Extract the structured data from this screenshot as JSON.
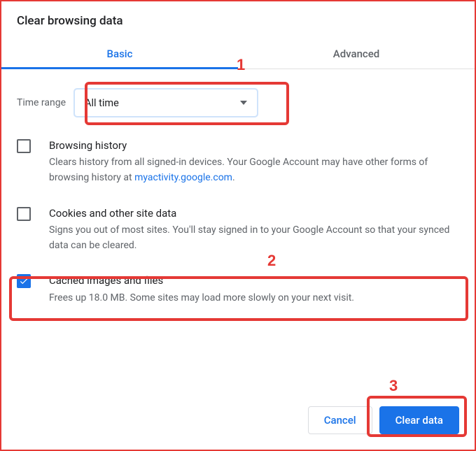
{
  "dialog": {
    "title": "Clear browsing data"
  },
  "tabs": {
    "basic": "Basic",
    "advanced": "Advanced"
  },
  "time_range": {
    "label": "Time range",
    "value": "All time"
  },
  "items": {
    "history": {
      "title": "Browsing history",
      "desc_pre": "Clears history from all signed-in devices. Your Google Account may have other forms of browsing history at ",
      "link": "myactivity.google.com",
      "desc_post": ".",
      "checked": false
    },
    "cookies": {
      "title": "Cookies and other site data",
      "desc": "Signs you out of most sites. You'll stay signed in to your Google Account so that your synced data can be cleared.",
      "checked": false
    },
    "cache": {
      "title": "Cached images and files",
      "desc": "Frees up 18.0 MB. Some sites may load more slowly on your next visit.",
      "checked": true
    }
  },
  "buttons": {
    "cancel": "Cancel",
    "clear": "Clear data"
  },
  "annotations": {
    "n1": "1",
    "n2": "2",
    "n3": "3"
  }
}
